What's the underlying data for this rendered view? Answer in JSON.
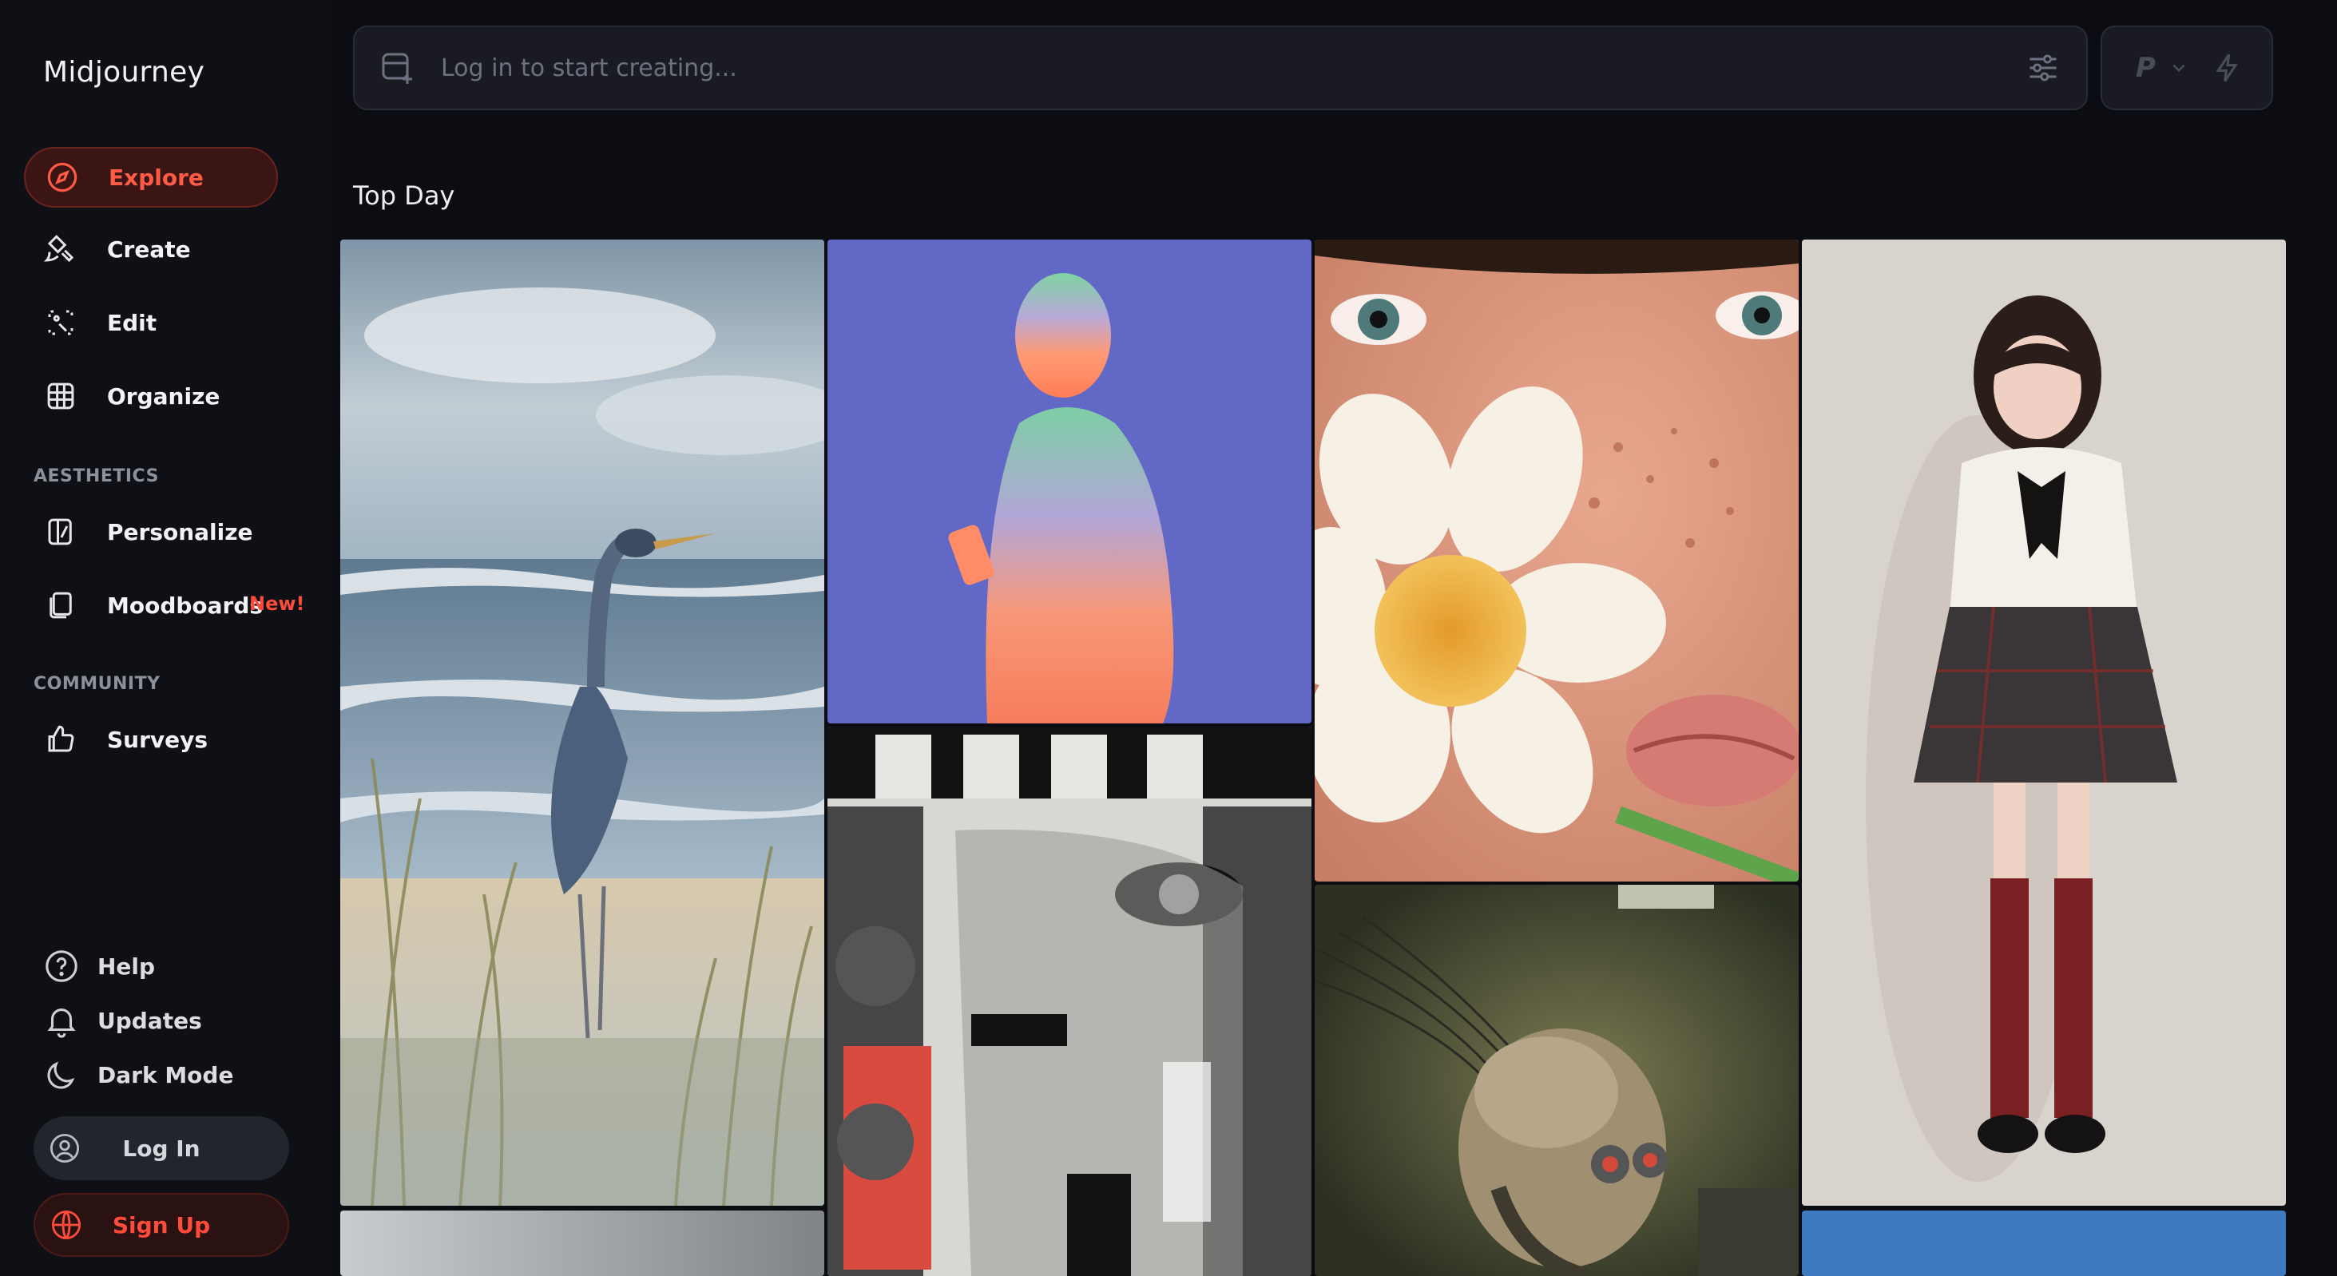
{
  "sidebar": {
    "brand": "Midjourney",
    "nav": [
      {
        "label": "Explore",
        "icon": "compass-icon"
      },
      {
        "label": "Create",
        "icon": "brush-icon"
      },
      {
        "label": "Edit",
        "icon": "edit-frame-icon"
      },
      {
        "label": "Organize",
        "icon": "grid-icon"
      }
    ],
    "aesthetics_label": "AESTHETICS",
    "aesthetics": [
      {
        "label": "Personalize",
        "icon": "personalize-icon"
      },
      {
        "label": "Moodboards",
        "icon": "moodboard-icon",
        "badge": "New!"
      }
    ],
    "community_label": "COMMUNITY",
    "community": [
      {
        "label": "Surveys",
        "icon": "thumbs-up-icon"
      }
    ],
    "utilities": [
      {
        "label": "Help",
        "icon": "help-icon"
      },
      {
        "label": "Updates",
        "icon": "bell-icon"
      },
      {
        "label": "Dark Mode",
        "icon": "moon-icon"
      }
    ],
    "login_label": "Log In",
    "signup_label": "Sign Up"
  },
  "prompt": {
    "placeholder": "Log in to start creating...",
    "mode_letter": "P"
  },
  "gallery": {
    "title": "Top Day",
    "images": [
      {
        "name": "heron-beach-painting"
      },
      {
        "name": "gradient-silhouette-phone"
      },
      {
        "name": "freckled-face-daisy"
      },
      {
        "name": "schoolgirl-plaid-skirt"
      },
      {
        "name": "punk-collage-face"
      },
      {
        "name": "cyborg-head"
      }
    ]
  },
  "colors": {
    "accent": "#ff4b3a",
    "background": "#0c0d12",
    "sidebar": "#0f1016"
  }
}
